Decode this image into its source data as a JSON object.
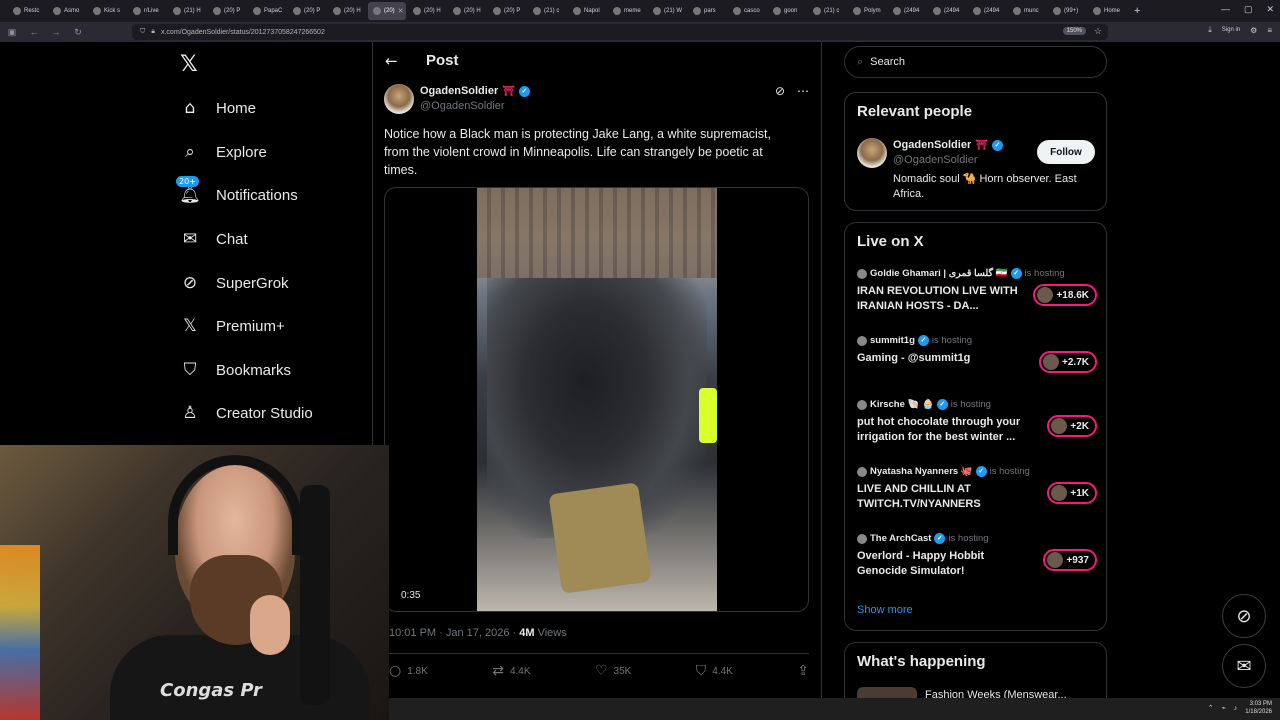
{
  "browser": {
    "tabs": [
      "Restc",
      "Asmo",
      "Kick s",
      "r/Live",
      "(21) H",
      "(20) P",
      "PapaC",
      "(20) P",
      "(20) H",
      "(20) ",
      "(20) H",
      "(20) H",
      "(20) P",
      "(21) c",
      "Napol",
      "meme",
      "(21) W",
      "pars",
      "casco",
      "goon",
      "(21) c",
      "Polym",
      "(2494",
      "(2494",
      "(2494",
      "munc",
      "(99+)",
      "Home"
    ],
    "active_tab_index": 9,
    "url": "x.com/OgadenSoldier/status/2012737058247266502",
    "zoom": "150%",
    "signin": "Sign in"
  },
  "logo": "𝕏",
  "nav": [
    {
      "label": "Home",
      "icon": "home-icon"
    },
    {
      "label": "Explore",
      "icon": "search-icon"
    },
    {
      "label": "Notifications",
      "icon": "bell-icon",
      "badge": "20+"
    },
    {
      "label": "Chat",
      "icon": "mail-icon"
    },
    {
      "label": "SuperGrok",
      "icon": "grok-icon"
    },
    {
      "label": "Premium+",
      "icon": "x-logo-icon"
    },
    {
      "label": "Bookmarks",
      "icon": "bookmark-icon"
    },
    {
      "label": "Creator Studio",
      "icon": "creator-icon"
    }
  ],
  "post": {
    "header": "Post",
    "author_name": "OgadenSoldier",
    "author_flag": "⛩",
    "author_handle": "@OgadenSoldier",
    "text": "Notice how a Black man is protecting Jake Lang, a white supremacist, from the violent crowd in Minneapolis. Life can strangely be poetic at times.",
    "video_duration": "0:35",
    "timestamp": "10:01 PM · Jan 17, 2026 · ",
    "views_count": "4M",
    "views_label": " Views",
    "replies": "1.8K",
    "reposts": "4.4K",
    "likes": "35K",
    "bookmarks": "4.4K"
  },
  "search": {
    "placeholder": "Search"
  },
  "relevant_people": {
    "title": "Relevant people",
    "name": "OgadenSoldier",
    "flag": "⛩",
    "handle": "@OgadenSoldier",
    "follow": "Follow",
    "bio": "Nomadic soul 🐪 Horn observer. East Africa."
  },
  "live": {
    "title": "Live on X",
    "hosting_label": "is hosting",
    "items": [
      {
        "host": "Goldie Ghamari | گلسا قمری 🇮🇷",
        "title": "IRAN REVOLUTION LIVE WITH IRANIAN HOSTS - DA...",
        "count": "+18.6K"
      },
      {
        "host": "summit1g",
        "title": "Gaming - @summit1g",
        "count": "+2.7K"
      },
      {
        "host": "Kirsche 🐚 🧁",
        "title": "put hot chocolate through your irrigation for the best winter ...",
        "count": "+2K"
      },
      {
        "host": "Nyatasha Nyanners 🐙",
        "title": "LIVE AND CHILLIN AT TWITCH.TV/NYANNERS",
        "count": "+1K"
      },
      {
        "host": "The ArchCast",
        "title": "Overlord - Happy Hobbit Genocide Simulator!",
        "count": "+937"
      }
    ],
    "show_more": "Show more"
  },
  "whats_happening": {
    "title": "What's happening",
    "peek": "Fashion Weeks (Menswear..."
  },
  "webcam": {
    "shirt_text": "Congas Pr"
  },
  "taskbar": {
    "time": "3:03 PM",
    "date": "1/18/2026"
  }
}
